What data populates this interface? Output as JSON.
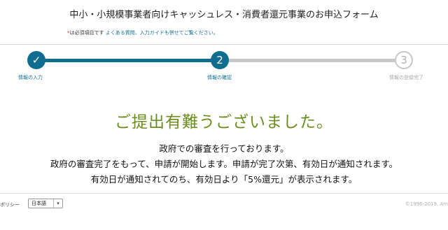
{
  "header": {
    "title": "中小・小規模事業者向けキャッシュレス・消費者還元事業のお申込フォーム",
    "required_mark": "*",
    "required_text": "は必須項目です",
    "help_link": "よくある質問、入力ガイドも併せてご覧ください。"
  },
  "steps": [
    {
      "number": "✓",
      "label": "情報の入力",
      "state": "done"
    },
    {
      "number": "2",
      "label": "情報の確認",
      "state": "current"
    },
    {
      "number": "3",
      "label": "情報の登録完了",
      "state": "pending"
    }
  ],
  "result": {
    "heading": "ご提出有難うございました。",
    "line1": "政府での審査を行っております。",
    "line2": "政府の審査完了をもって、申請が開始します。申請が完了次第、有効日が通知されます。",
    "line3": "有効日が通知されてのち、有効日より「5%還元」が表示されます。"
  },
  "footer": {
    "policy_label": "ポリシー",
    "language_selected": "日本語",
    "copyright": "©1996-2019, Am"
  },
  "colors": {
    "accent": "#0f6e8f",
    "heading_green": "#6b8e1f",
    "inactive": "#c8c8c8"
  }
}
